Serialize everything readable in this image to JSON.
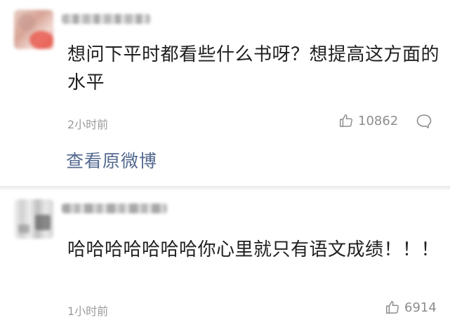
{
  "comments": [
    {
      "text": "想问下平时都看些什么书呀？想提高这方面的水平",
      "time": "2小时前",
      "likes": "10862"
    },
    {
      "text": "哈哈哈哈哈哈哈你心里就只有语文成绩！！！",
      "time": "1小时前",
      "likes": "6914"
    }
  ],
  "view_original_label": "查看原微博",
  "icons": {
    "like": "thumbs-up-icon",
    "reply": "comment-bubble-icon"
  },
  "colors": {
    "text": "#202020",
    "meta": "#9b9b9b",
    "link": "#53698f",
    "separator": "#f1f1f1"
  }
}
